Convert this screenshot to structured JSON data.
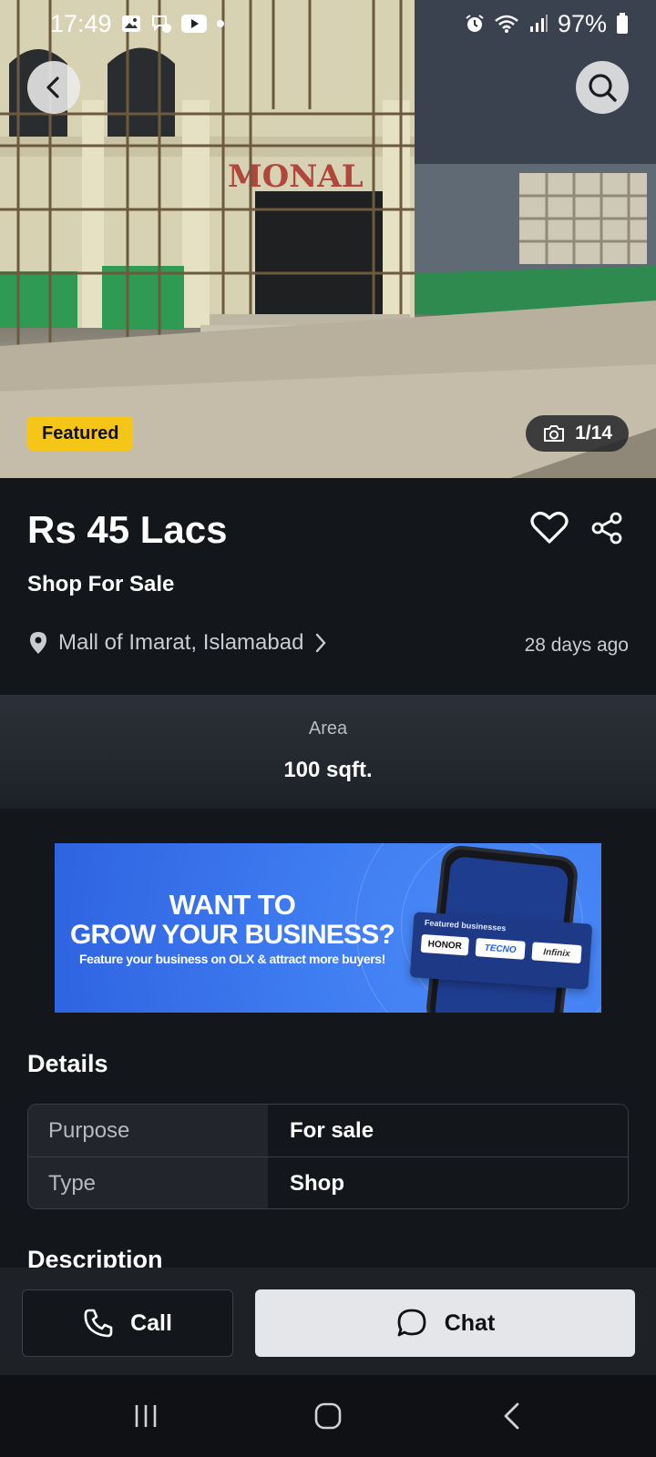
{
  "status_bar": {
    "time": "17:49",
    "battery": "97%"
  },
  "hero": {
    "featured_label": "Featured",
    "photo_counter": "1/14"
  },
  "listing": {
    "price": "Rs 45 Lacs",
    "title": "Shop For Sale",
    "location": "Mall of Imarat, Islamabad",
    "posted": "28 days ago",
    "area_label": "Area",
    "area_value": "100 sqft."
  },
  "banner": {
    "headline_1": "WANT TO",
    "headline_2": "GROW YOUR BUSINESS?",
    "subline": "Feature your business on OLX & attract more buyers!",
    "card_title": "Featured businesses",
    "brands": [
      "HONOR",
      "TECNO",
      "Infinix"
    ]
  },
  "details": {
    "heading": "Details",
    "rows": [
      {
        "key": "Purpose",
        "value": "For sale"
      },
      {
        "key": "Type",
        "value": "Shop"
      }
    ]
  },
  "description": {
    "heading": "Description"
  },
  "actions": {
    "call_label": "Call",
    "chat_label": "Chat"
  },
  "colors": {
    "featured": "#f5c518",
    "background": "#13161b",
    "chat_button": "#e4e6ea"
  }
}
